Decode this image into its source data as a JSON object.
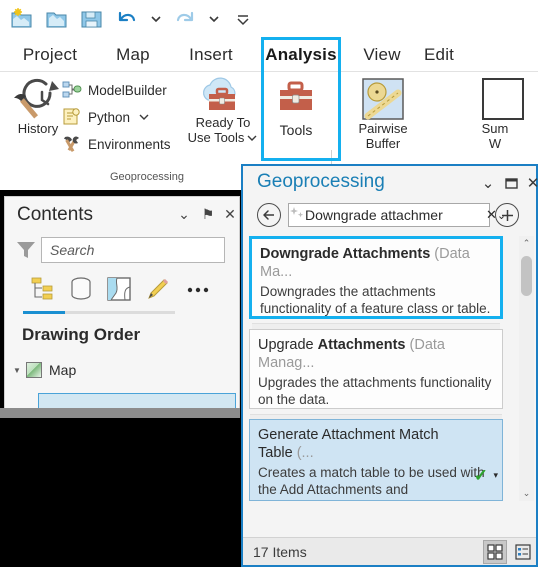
{
  "quick_access": {
    "items": [
      {
        "name": "new-project-icon",
        "label": "New Project"
      },
      {
        "name": "open-project-icon",
        "label": "Open Project"
      },
      {
        "name": "save-project-icon",
        "label": "Save Project"
      },
      {
        "name": "undo-icon",
        "label": "Undo"
      },
      {
        "name": "undo-dropdown-icon",
        "label": "Undo options"
      },
      {
        "name": "redo-icon",
        "label": "Redo"
      },
      {
        "name": "redo-dropdown-icon",
        "label": "Redo options"
      },
      {
        "name": "customize-quick-access-icon",
        "label": "Customize Quick Access Toolbar"
      }
    ]
  },
  "ribbon": {
    "tabs": [
      {
        "label": "Project",
        "selected": false
      },
      {
        "label": "Map",
        "selected": false
      },
      {
        "label": "Insert",
        "selected": false
      },
      {
        "label": "Analysis",
        "selected": true
      },
      {
        "label": "View",
        "selected": false
      },
      {
        "label": "Edit",
        "selected": false
      }
    ],
    "group_label": "Geoprocessing",
    "buttons": {
      "history": "History",
      "model_builder": "ModelBuilder",
      "python": "Python",
      "environments": "Environments",
      "ready_to_use_tools_line1": "Ready To",
      "ready_to_use_tools_line2": "Use Tools",
      "tools": "Tools",
      "pairwise_buffer_line1": "Pairwise",
      "pairwise_buffer_line2": "Buffer",
      "summarize_within_line1": "Sum",
      "summarize_within_line2": "W"
    },
    "highlight_color": "#14b0ef",
    "tab_accent_color": "#0078c8"
  },
  "contents": {
    "title": "Contents",
    "header_buttons": [
      {
        "name": "contents-menu-icon",
        "glyph": "⌄"
      },
      {
        "name": "contents-pin-icon",
        "glyph": "⚑"
      },
      {
        "name": "contents-close-icon",
        "glyph": "✕"
      }
    ],
    "search_placeholder": "Search",
    "search_value": "",
    "toolbar_icons": [
      "list-by-drawing-order-icon",
      "list-by-data-source-icon",
      "list-by-selection-icon",
      "list-by-editing-icon",
      "more-options-icon"
    ],
    "section_heading": "Drawing Order",
    "tree": [
      {
        "label": "Map",
        "icon": "map-icon",
        "expanded": true
      }
    ]
  },
  "geoprocessing": {
    "title": "Geoprocessing",
    "header_buttons": [
      {
        "name": "gp-menu-icon",
        "glyph": "⌄"
      },
      {
        "name": "gp-maximize-icon",
        "glyph": "❐"
      },
      {
        "name": "gp-close-icon",
        "glyph": "✕"
      }
    ],
    "back_button": "←",
    "add_button": "+",
    "search": {
      "value": "Downgrade attachmer",
      "placeholder": "Search",
      "clear_glyph": "✕",
      "dropdown_glyph": "⌄",
      "sparkle_icon": "ai-search-icon"
    },
    "results": [
      {
        "title_plain": "",
        "title_bold": "Downgrade Attachments",
        "toolbox": "(Data Ma...",
        "description": "Downgrades the attachments functionality of a feature class or table.",
        "tool_icon": "hammer-tool-icon",
        "state": "selected",
        "has_check": false
      },
      {
        "title_plain": "Upgrade ",
        "title_bold": "Attachments",
        "toolbox": "(Data Manag...",
        "description": "Upgrades the attachments functionality on the data.",
        "tool_icon": "hammer-tool-icon",
        "state": "normal",
        "has_check": false
      },
      {
        "title_plain": "Generate Attachment Match Table",
        "title_bold": "",
        "toolbox": "(...",
        "description": "Creates a match table to be used with the Add Attachments and",
        "tool_icon": "",
        "state": "highlight",
        "has_check": true,
        "check_glyph": "✓",
        "check_caret": "▾"
      }
    ],
    "status": {
      "item_count": "17 Items",
      "view_buttons": [
        {
          "name": "grid-view-button",
          "active": true
        },
        {
          "name": "list-view-button",
          "active": false
        }
      ]
    },
    "scrollbar": {
      "up_glyph": "⌃",
      "down_glyph": "⌄"
    },
    "border_color": "#1b7fc4",
    "title_color": "#1a7fb5"
  }
}
